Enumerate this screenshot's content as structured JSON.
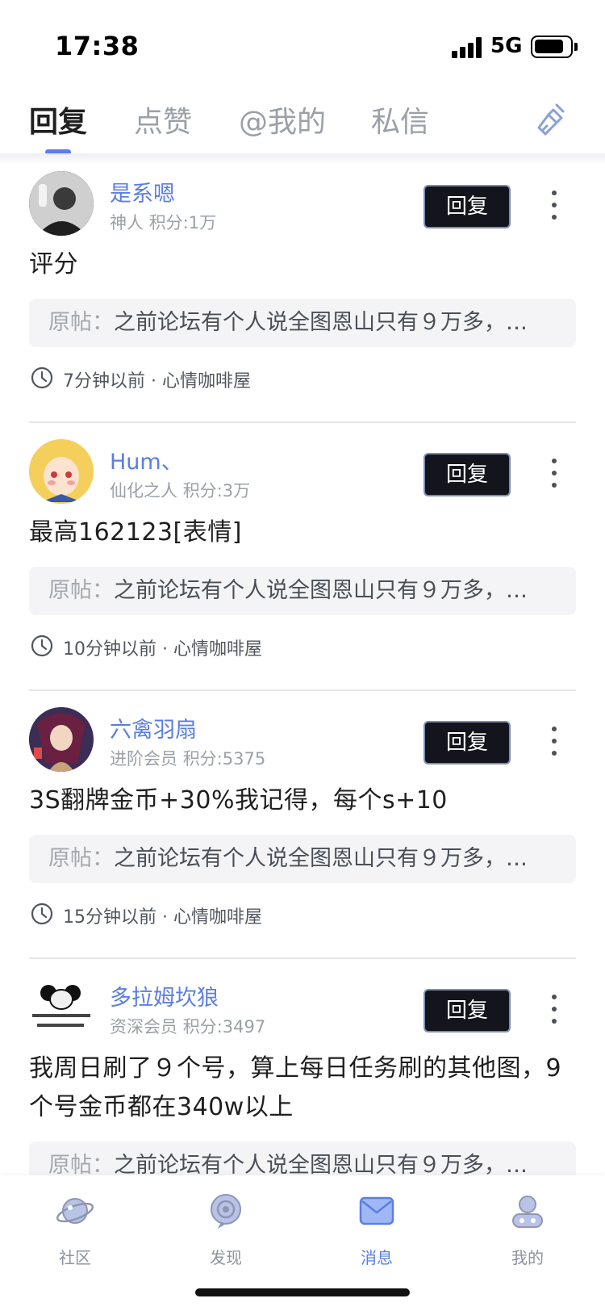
{
  "status_bar": {
    "time": "17:38",
    "network": "5G"
  },
  "tabs": [
    {
      "label": "回复",
      "active": true
    },
    {
      "label": "点赞",
      "active": false
    },
    {
      "label": "@我的",
      "active": false
    },
    {
      "label": "私信",
      "active": false
    }
  ],
  "clear_icon": "broom-icon",
  "posts": [
    {
      "username": "是系嗯",
      "level": "神人",
      "points": "积分:1万",
      "comment": "评分",
      "quote_label": "原帖：",
      "quote_text": "之前论坛有个人说全图恩山只有９万多，…",
      "time": "7分钟以前",
      "separator": "·",
      "forum": "心情咖啡屋",
      "reply_label": "回复"
    },
    {
      "username": "Hum、",
      "level": "仙化之人",
      "points": "积分:3万",
      "comment": "最高162123[表情]",
      "quote_label": "原帖：",
      "quote_text": "之前论坛有个人说全图恩山只有９万多，…",
      "time": "10分钟以前",
      "separator": "·",
      "forum": "心情咖啡屋",
      "reply_label": "回复"
    },
    {
      "username": "六禽羽扇",
      "level": "进阶会员",
      "points": "积分:5375",
      "comment": "3S翻牌金币+30%我记得，每个s+10",
      "quote_label": "原帖：",
      "quote_text": "之前论坛有个人说全图恩山只有９万多，…",
      "time": "15分钟以前",
      "separator": "·",
      "forum": "心情咖啡屋",
      "reply_label": "回复"
    },
    {
      "username": "多拉姆坎狼",
      "level": "资深会员",
      "points": "积分:3497",
      "comment": "我周日刷了９个号，算上每日任务刷的其他图，9个号金币都在340w以上",
      "quote_label": "原帖：",
      "quote_text": "之前论坛有个人说全图恩山只有９万多，…",
      "reply_label": "回复"
    }
  ],
  "bottom_nav": [
    {
      "label": "社区",
      "icon": "planet-icon",
      "active": false
    },
    {
      "label": "发现",
      "icon": "discover-icon",
      "active": false
    },
    {
      "label": "消息",
      "icon": "message-icon",
      "active": true
    },
    {
      "label": "我的",
      "icon": "profile-icon",
      "active": false
    }
  ],
  "colors": {
    "accent": "#5b7ee3",
    "reply_button_bg": "#14141c",
    "quote_bg": "#f4f4f6"
  }
}
